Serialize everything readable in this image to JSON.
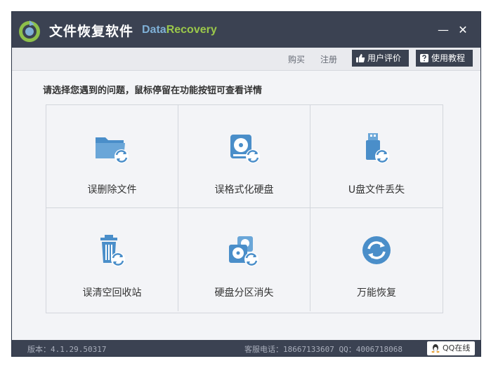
{
  "window": {
    "title": "文件恢复软件",
    "brand_part1": "Data",
    "brand_part2": "Recovery",
    "minimize_glyph": "—",
    "close_glyph": "✕"
  },
  "toolbar": {
    "buy_label": "购买",
    "register_label": "注册",
    "review_label": "用户评价",
    "tutorial_label": "使用教程",
    "review_icon": "thumbs-up-icon",
    "tutorial_icon": "help-icon"
  },
  "main": {
    "prompt": "请选择您遇到的问题，鼠标停留在功能按钮可查看详情",
    "options": [
      {
        "label": "误删除文件",
        "icon": "folder-recover-icon"
      },
      {
        "label": "误格式化硬盘",
        "icon": "disk-recover-icon"
      },
      {
        "label": "U盘文件丢失",
        "icon": "usb-recover-icon"
      },
      {
        "label": "误清空回收站",
        "icon": "trash-recover-icon"
      },
      {
        "label": "硬盘分区消失",
        "icon": "partition-recover-icon"
      },
      {
        "label": "万能恢复",
        "icon": "universal-recover-icon"
      }
    ]
  },
  "status": {
    "version": "版本：4.1.29.50317",
    "contact": "客服电话：18667133607 QQ：4006718068",
    "qq_label": "QQ在线"
  },
  "colors": {
    "titlebar": "#3b4252",
    "icon_blue": "#4a8ec9",
    "brand_blue": "#7fb0d6",
    "brand_green": "#9bc84a"
  }
}
